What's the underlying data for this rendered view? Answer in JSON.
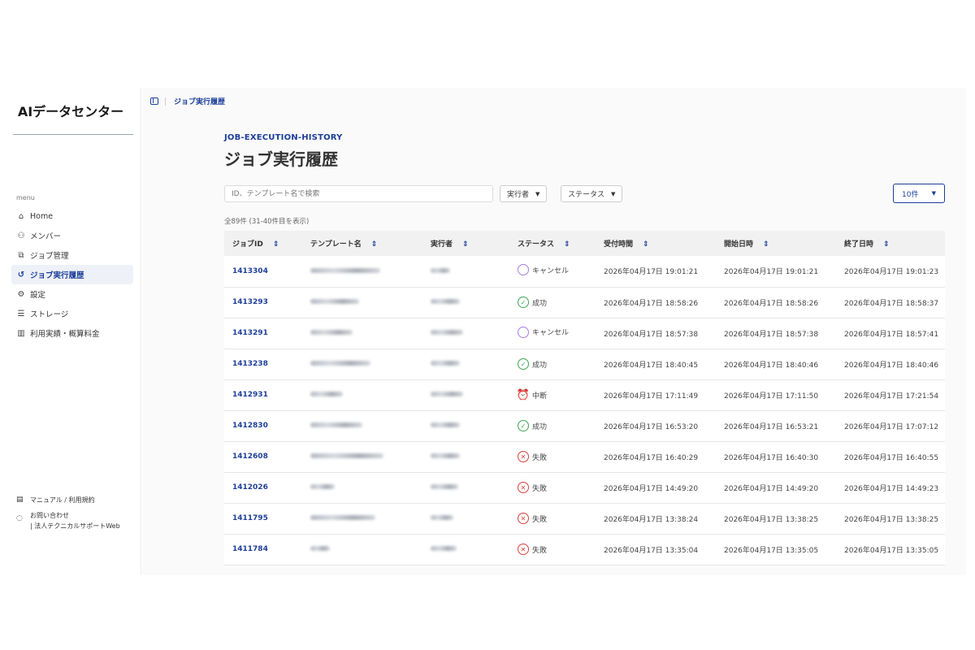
{
  "app": {
    "brand": "AIデータセンター",
    "menu_label": "menu"
  },
  "nav": [
    {
      "label": "Home",
      "icon": "home-icon"
    },
    {
      "label": "メンバー",
      "icon": "members-icon"
    },
    {
      "label": "ジョブ管理",
      "icon": "copy-icon"
    },
    {
      "label": "ジョブ実行履歴",
      "icon": "history-icon",
      "active": true
    },
    {
      "label": "設定",
      "icon": "gear-icon"
    },
    {
      "label": "ストレージ",
      "icon": "storage-icon"
    },
    {
      "label": "利用実績・概算料金",
      "icon": "chart-icon"
    }
  ],
  "footer": {
    "manual": "マニュアル / 利用規約",
    "contact_line1": "お問い合わせ",
    "contact_line2": "| 法人テクニカルサポートWeb"
  },
  "breadcrumb": "ジョブ実行履歴",
  "page": {
    "eyebrow": "JOB-EXECUTION-HISTORY",
    "title": "ジョブ実行履歴"
  },
  "filters": {
    "search_placeholder": "ID、テンプレート名で検索",
    "executor": "実行者",
    "status": "ステータス",
    "per_page": "10件"
  },
  "count_text": "全89件 (31-40件目を表示)",
  "table": {
    "headers": [
      "ジョブID",
      "テンプレート名",
      "実行者",
      "ステータス",
      "受付時間",
      "開始日時",
      "終了日時"
    ],
    "rows": [
      {
        "id": "1413304",
        "status": "キャンセル",
        "kind": "cancel",
        "received": "2026年04月17日 19:01:21",
        "start": "2026年04月17日 19:01:21",
        "end": "2026年04月17日 19:01:23"
      },
      {
        "id": "1413293",
        "status": "成功",
        "kind": "ok",
        "received": "2026年04月17日 18:58:26",
        "start": "2026年04月17日 18:58:26",
        "end": "2026年04月17日 18:58:37"
      },
      {
        "id": "1413291",
        "status": "キャンセル",
        "kind": "cancel",
        "received": "2026年04月17日 18:57:38",
        "start": "2026年04月17日 18:57:38",
        "end": "2026年04月17日 18:57:41"
      },
      {
        "id": "1413238",
        "status": "成功",
        "kind": "ok",
        "received": "2026年04月17日 18:40:45",
        "start": "2026年04月17日 18:40:46",
        "end": "2026年04月17日 18:40:46"
      },
      {
        "id": "1412931",
        "status": "中断",
        "kind": "stop",
        "received": "2026年04月17日 17:11:49",
        "start": "2026年04月17日 17:11:50",
        "end": "2026年04月17日 17:21:54"
      },
      {
        "id": "1412830",
        "status": "成功",
        "kind": "ok",
        "received": "2026年04月17日 16:53:20",
        "start": "2026年04月17日 16:53:21",
        "end": "2026年04月17日 17:07:12"
      },
      {
        "id": "1412608",
        "status": "失敗",
        "kind": "fail",
        "received": "2026年04月17日 16:40:29",
        "start": "2026年04月17日 16:40:30",
        "end": "2026年04月17日 16:40:55"
      },
      {
        "id": "1412026",
        "status": "失敗",
        "kind": "fail",
        "received": "2026年04月17日 14:49:20",
        "start": "2026年04月17日 14:49:20",
        "end": "2026年04月17日 14:49:23"
      },
      {
        "id": "1411795",
        "status": "失敗",
        "kind": "fail",
        "received": "2026年04月17日 13:38:24",
        "start": "2026年04月17日 13:38:25",
        "end": "2026年04月17日 13:38:25"
      },
      {
        "id": "1411784",
        "status": "失敗",
        "kind": "fail",
        "received": "2026年04月17日 13:35:04",
        "start": "2026年04月17日 13:35:05",
        "end": "2026年04月17日 13:35:05"
      }
    ]
  },
  "colors": {
    "accent": "#1d3f99",
    "cancel": "#a67ee6",
    "success": "#3fa552",
    "failure": "#d9413b",
    "interrupted": "#e08a2a"
  }
}
